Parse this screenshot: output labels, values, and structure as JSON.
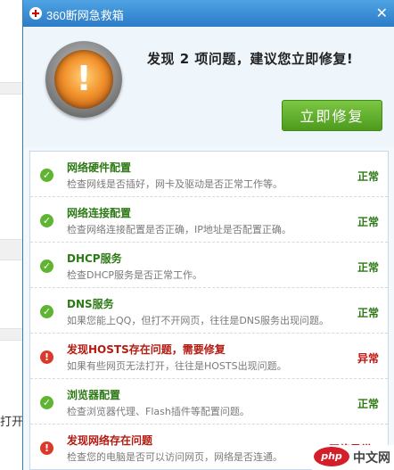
{
  "window": {
    "title": "360断网急救箱"
  },
  "header": {
    "headline": "发现 2 项问题，建议您立即修复!",
    "fix_button": "立即修复"
  },
  "background": {
    "partial_text": "打开"
  },
  "items": [
    {
      "name": "网络硬件配置",
      "desc": "检查网线是否插好，网卡及驱动是否正常工作等。",
      "result": "正常",
      "status": "ok"
    },
    {
      "name": "网络连接配置",
      "desc": "检查网络连接配置是否正确，IP地址是否配置正确。",
      "result": "正常",
      "status": "ok"
    },
    {
      "name": "DHCP服务",
      "desc": "检查DHCP服务是否正常工作。",
      "result": "正常",
      "status": "ok"
    },
    {
      "name": "DNS服务",
      "desc": "如果您能上QQ，但打不开网页，往往是DNS服务出现问题。",
      "result": "正常",
      "status": "ok"
    },
    {
      "name": "发现HOSTS存在问题，需要修复",
      "desc": "如果有些网页无法打开，往往是HOSTS出现问题。",
      "result": "异常",
      "status": "error"
    },
    {
      "name": "浏览器配置",
      "desc": "检查浏览器代理、Flash插件等配置问题。",
      "result": "正常",
      "status": "ok"
    },
    {
      "name": "发现网络存在问题",
      "desc": "检查您的电脑是否可以访问网页，网络是否连通。",
      "result": "网络异常",
      "status": "error"
    }
  ],
  "watermark": {
    "logo": "php",
    "site": "中文网"
  },
  "colors": {
    "ok": "#5fb531",
    "error": "#d93a2b",
    "titlebar": "#2b7bc7",
    "fix_button": "#5aa826"
  },
  "icons": {
    "ok": "check-icon",
    "error": "exclamation-icon",
    "alarm": "warning-alarm-icon"
  }
}
